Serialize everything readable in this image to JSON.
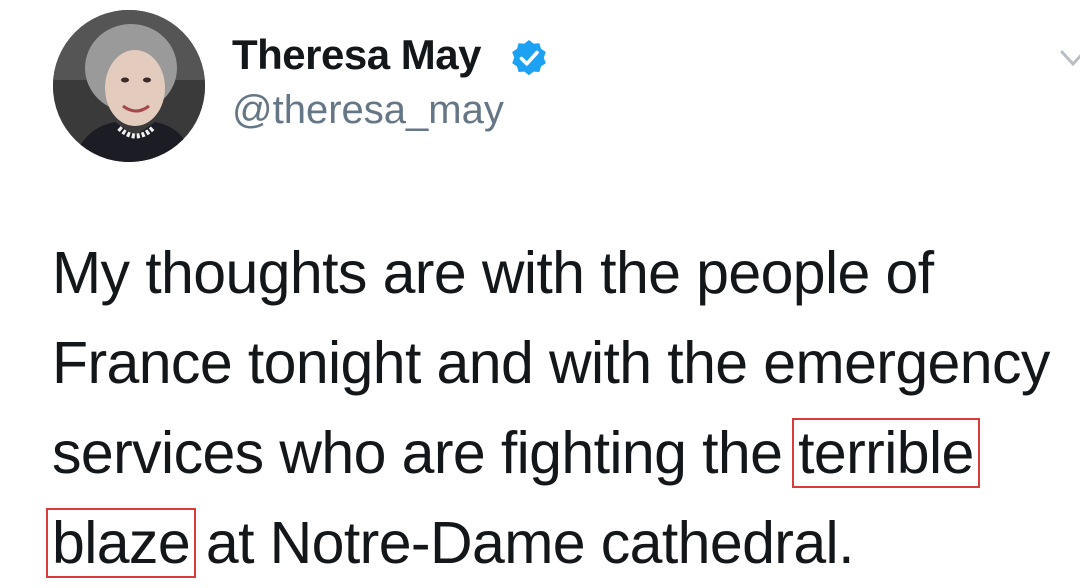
{
  "author": {
    "display_name": "Theresa May",
    "handle": "@theresa_may",
    "verified": true,
    "verified_color": "#1da1f2"
  },
  "icons": {
    "verified": "verified-badge-icon",
    "menu": "chevron-down-icon"
  },
  "tweet": {
    "lines": [
      "My thoughts are with the people of",
      "France tonight and with the emergency",
      "services who are fighting the",
      "at Notre-Dame cathedral."
    ],
    "highlight_1": "terrible",
    "highlight_2": "blaze",
    "highlight_color": "#d93a3a"
  }
}
